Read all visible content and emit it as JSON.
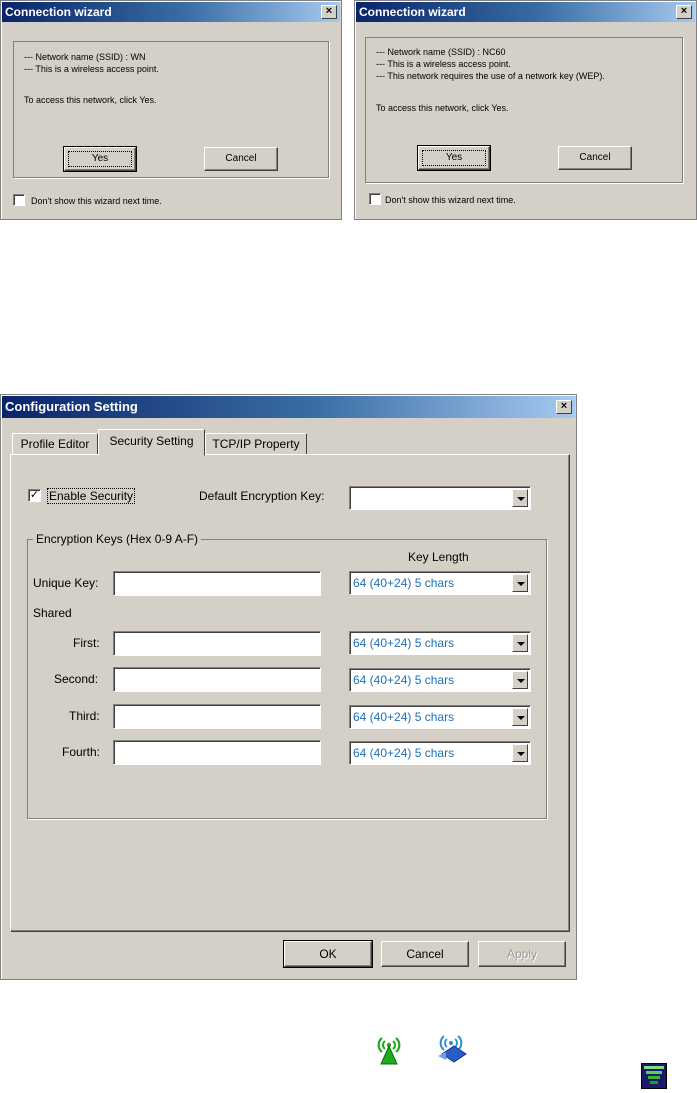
{
  "wizard_left": {
    "title": "Connection wizard",
    "close": "×",
    "lines": [
      "--- Network name (SSID) : WN",
      "--- This is a wireless access point.",
      "",
      "To access this network, click Yes."
    ],
    "yes_label": "Yes",
    "cancel_label": "Cancel",
    "dont_show_label": "Don't show this wizard next time."
  },
  "wizard_right": {
    "title": "Connection wizard",
    "close": "×",
    "lines": [
      "--- Network name (SSID) : NC60",
      "--- This is a wireless access point.",
      "--- This network requires the use of a network key (WEP).",
      "",
      "To access this network, click Yes."
    ],
    "yes_label": "Yes",
    "cancel_label": "Cancel",
    "dont_show_label": "Don't show this wizard next time."
  },
  "config": {
    "title": "Configuration Setting",
    "close": "×",
    "tabs": [
      "Profile Editor",
      "Security Setting",
      "TCP/IP Property"
    ],
    "active_tab": "Security Setting",
    "enable_security_label": "Enable Security",
    "enable_security_checked": true,
    "default_key_label": "Default Encryption Key:",
    "default_key_value": "",
    "group_title": "Encryption Keys (Hex 0-9 A-F)",
    "key_length_header": "Key Length",
    "unique_key_label": "Unique Key:",
    "shared_label": "Shared",
    "keys": [
      {
        "label": "Unique Key:",
        "value": "",
        "length": "64  (40+24)  5 chars"
      },
      {
        "label": "First:",
        "value": "",
        "length": "64  (40+24)  5 chars"
      },
      {
        "label": "Second:",
        "value": "",
        "length": "64  (40+24)  5 chars"
      },
      {
        "label": "Third:",
        "value": "",
        "length": "64  (40+24)  5 chars"
      },
      {
        "label": "Fourth:",
        "value": "",
        "length": "64  (40+24)  5 chars"
      }
    ],
    "ok_label": "OK",
    "cancel_label": "Cancel",
    "apply_label": "Apply"
  },
  "icons": {
    "signal_tower": "signal-tower-icon",
    "network_scan": "network-scan-icon",
    "signal_bars": "signal-strength-icon",
    "tower_color": "#21a81d",
    "network_color": "#2a5cc8",
    "bars_color": "#3ab53a"
  }
}
